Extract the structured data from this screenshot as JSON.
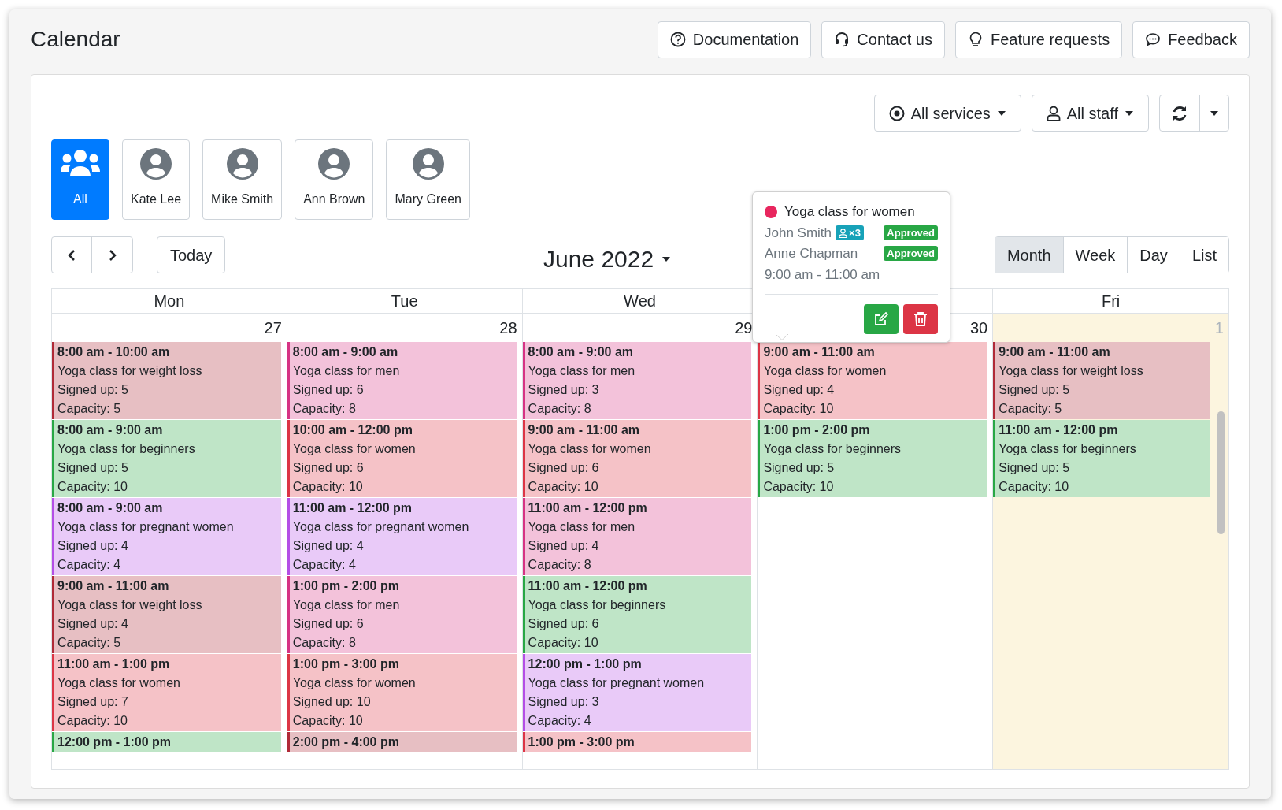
{
  "page_title": "Calendar",
  "header_buttons": [
    {
      "label": "Documentation",
      "kind": "help"
    },
    {
      "label": "Contact us",
      "kind": "headset"
    },
    {
      "label": "Feature requests",
      "kind": "bulb"
    },
    {
      "label": "Feedback",
      "kind": "chat"
    }
  ],
  "filters": {
    "services": "All services",
    "staff": "All staff"
  },
  "staff": [
    {
      "name": "All",
      "kind": "group",
      "selected": true
    },
    {
      "name": "Kate Lee",
      "kind": "person",
      "selected": false
    },
    {
      "name": "Mike Smith",
      "kind": "person",
      "selected": false
    },
    {
      "name": "Ann Brown",
      "kind": "person",
      "selected": false
    },
    {
      "name": "Mary Green",
      "kind": "person",
      "selected": false
    }
  ],
  "nav": {
    "today": "Today",
    "period": "June 2022"
  },
  "views": [
    {
      "label": "Month",
      "selected": true
    },
    {
      "label": "Week",
      "selected": false
    },
    {
      "label": "Day",
      "selected": false
    },
    {
      "label": "List",
      "selected": false
    }
  ],
  "days": [
    {
      "weekday": "Mon",
      "date": "27",
      "other_month": false,
      "today": false,
      "events": [
        {
          "time": "8:00 am - 10:00 am",
          "title": "Yoga class for weight loss",
          "signed_up": "Signed up: 5",
          "capacity": "Capacity: 5",
          "color": "#b02a37"
        },
        {
          "time": "8:00 am - 9:00 am",
          "title": "Yoga class for beginners",
          "signed_up": "Signed up: 5",
          "capacity": "Capacity: 10",
          "color": "#28a745"
        },
        {
          "time": "8:00 am - 9:00 am",
          "title": "Yoga class for pregnant women",
          "signed_up": "Signed up: 4",
          "capacity": "Capacity: 4",
          "color": "#b44ee6"
        },
        {
          "time": "9:00 am - 11:00 am",
          "title": "Yoga class for weight loss",
          "signed_up": "Signed up: 4",
          "capacity": "Capacity: 5",
          "color": "#b02a37"
        },
        {
          "time": "11:00 am - 1:00 pm",
          "title": "Yoga class for women",
          "signed_up": "Signed up: 7",
          "capacity": "Capacity: 10",
          "color": "#dc3545"
        },
        {
          "time": "12:00 pm - 1:00 pm",
          "color": "#28a745"
        }
      ]
    },
    {
      "weekday": "Tue",
      "date": "28",
      "other_month": false,
      "today": false,
      "events": [
        {
          "time": "8:00 am - 9:00 am",
          "title": "Yoga class for men",
          "signed_up": "Signed up: 6",
          "capacity": "Capacity: 8",
          "color": "#d63384"
        },
        {
          "time": "10:00 am - 12:00 pm",
          "title": "Yoga class for women",
          "signed_up": "Signed up: 6",
          "capacity": "Capacity: 10",
          "color": "#dc3545"
        },
        {
          "time": "11:00 am - 12:00 pm",
          "title": "Yoga class for pregnant women",
          "signed_up": "Signed up: 4",
          "capacity": "Capacity: 4",
          "color": "#b44ee6"
        },
        {
          "time": "1:00 pm - 2:00 pm",
          "title": "Yoga class for men",
          "signed_up": "Signed up: 6",
          "capacity": "Capacity: 8",
          "color": "#d63384"
        },
        {
          "time": "1:00 pm - 3:00 pm",
          "title": "Yoga class for women",
          "signed_up": "Signed up: 10",
          "capacity": "Capacity: 10",
          "color": "#dc3545"
        },
        {
          "time": "2:00 pm - 4:00 pm",
          "color": "#b02a37"
        }
      ]
    },
    {
      "weekday": "Wed",
      "date": "29",
      "other_month": false,
      "today": false,
      "events": [
        {
          "time": "8:00 am - 9:00 am",
          "title": "Yoga class for men",
          "signed_up": "Signed up: 3",
          "capacity": "Capacity: 8",
          "color": "#d63384"
        },
        {
          "time": "9:00 am - 11:00 am",
          "title": "Yoga class for women",
          "signed_up": "Signed up: 6",
          "capacity": "Capacity: 10",
          "color": "#dc3545"
        },
        {
          "time": "11:00 am - 12:00 pm",
          "title": "Yoga class for men",
          "signed_up": "Signed up: 4",
          "capacity": "Capacity: 8",
          "color": "#d63384"
        },
        {
          "time": "11:00 am - 12:00 pm",
          "title": "Yoga class for beginners",
          "signed_up": "Signed up: 6",
          "capacity": "Capacity: 10",
          "color": "#28a745"
        },
        {
          "time": "12:00 pm - 1:00 pm",
          "title": "Yoga class for pregnant women",
          "signed_up": "Signed up: 3",
          "capacity": "Capacity: 4",
          "color": "#b44ee6"
        },
        {
          "time": "1:00 pm - 3:00 pm",
          "color": "#dc3545"
        }
      ]
    },
    {
      "date": "30",
      "other_month": false,
      "today": false,
      "events": [
        {
          "time": "9:00 am - 11:00 am",
          "title": "Yoga class for women",
          "signed_up": "Signed up: 4",
          "capacity": "Capacity: 10",
          "color": "#dc3545"
        },
        {
          "time": "1:00 pm - 2:00 pm",
          "title": "Yoga class for beginners",
          "signed_up": "Signed up: 5",
          "capacity": "Capacity: 10",
          "color": "#28a745"
        }
      ]
    },
    {
      "weekday": "Fri",
      "date": "1",
      "other_month": true,
      "today": true,
      "events": [
        {
          "time": "9:00 am - 11:00 am",
          "title": "Yoga class for weight loss",
          "signed_up": "Signed up: 5",
          "capacity": "Capacity: 5",
          "color": "#b02a37"
        },
        {
          "time": "11:00 am - 12:00 pm",
          "title": "Yoga class for beginners",
          "signed_up": "Signed up: 5",
          "capacity": "Capacity: 10",
          "color": "#28a745"
        }
      ]
    }
  ],
  "popover": {
    "title": "Yoga class for women",
    "color": "#e8265e",
    "time": "9:00 am - 11:00 am",
    "bookings": [
      {
        "name": "John Smith",
        "guests": "×3",
        "status": "Approved"
      },
      {
        "name": "Anne Chapman",
        "status": "Approved"
      }
    ]
  }
}
